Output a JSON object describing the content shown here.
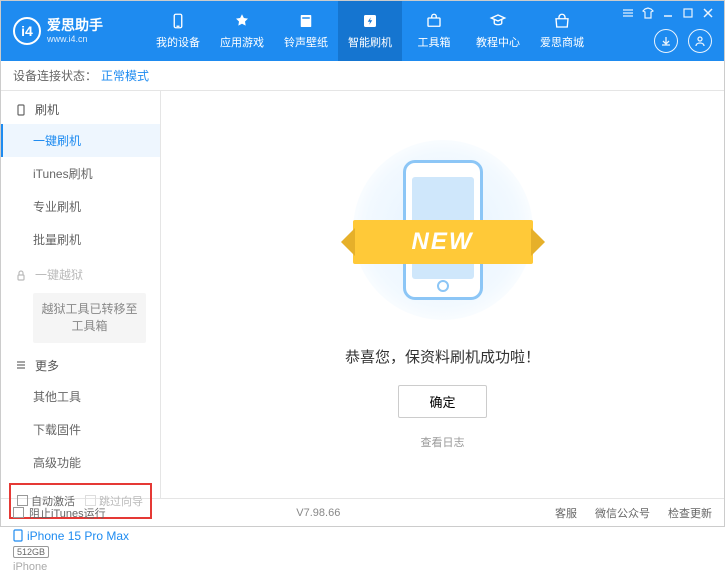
{
  "app": {
    "title": "爱思助手",
    "url": "www.i4.cn"
  },
  "nav": [
    {
      "label": "我的设备"
    },
    {
      "label": "应用游戏"
    },
    {
      "label": "铃声壁纸"
    },
    {
      "label": "智能刷机",
      "active": true
    },
    {
      "label": "工具箱"
    },
    {
      "label": "教程中心"
    },
    {
      "label": "爱思商城"
    }
  ],
  "status": {
    "label": "设备连接状态：",
    "value": "正常模式"
  },
  "sidebar": {
    "flash_section": "刷机",
    "items1": [
      "一键刷机",
      "iTunes刷机",
      "专业刷机",
      "批量刷机"
    ],
    "jailbreak_section": "一键越狱",
    "jailbreak_note": "越狱工具已转移至工具箱",
    "more_section": "更多",
    "items2": [
      "其他工具",
      "下载固件",
      "高级功能"
    ],
    "cb1": "自动激活",
    "cb2": "跳过向导"
  },
  "device": {
    "name": "iPhone 15 Pro Max",
    "storage": "512GB",
    "type": "iPhone"
  },
  "main": {
    "ribbon": "NEW",
    "message": "恭喜您，保资料刷机成功啦！",
    "ok": "确定",
    "log": "查看日志"
  },
  "footer": {
    "itunes": "阻止iTunes运行",
    "version": "V7.98.66",
    "links": [
      "客服",
      "微信公众号",
      "检查更新"
    ]
  }
}
